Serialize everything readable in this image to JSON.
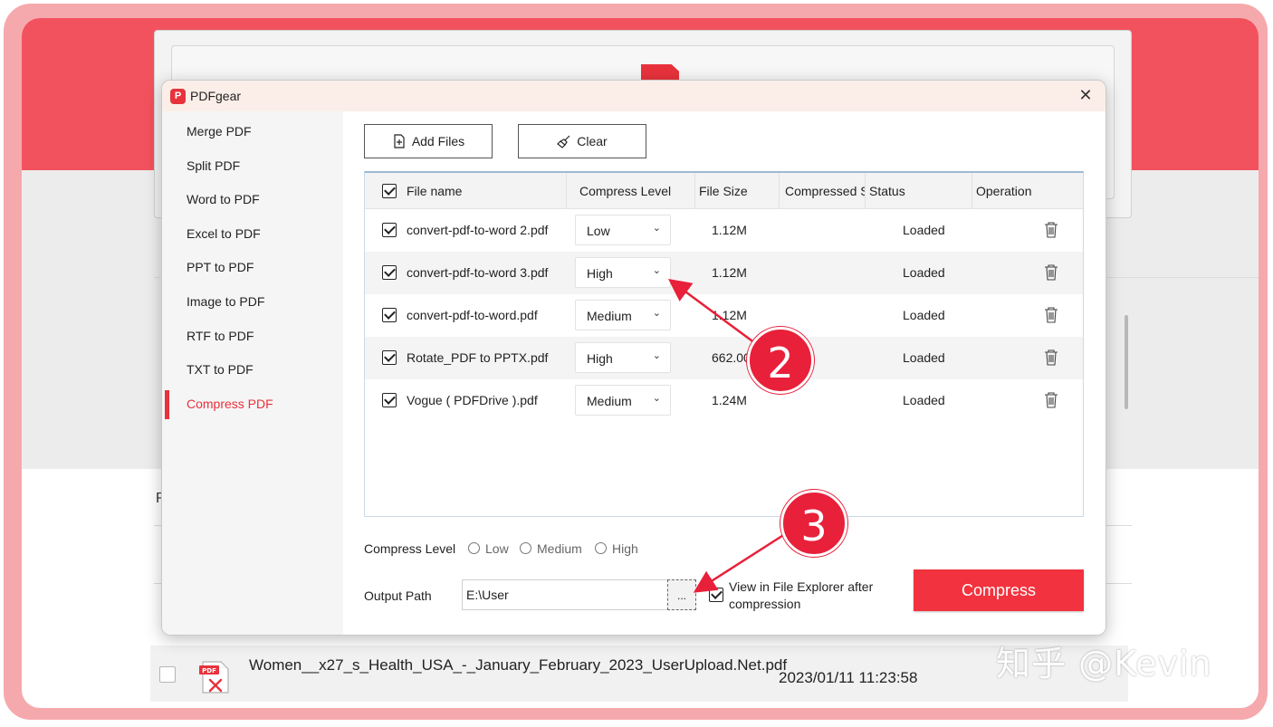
{
  "app": {
    "title": "PDFgear",
    "close_glyph": "✕",
    "icon": "pdfgear-logo-icon"
  },
  "sidebar": {
    "items": [
      {
        "label": "Merge PDF"
      },
      {
        "label": "Split PDF"
      },
      {
        "label": "Word to PDF"
      },
      {
        "label": "Excel to PDF"
      },
      {
        "label": "PPT to PDF"
      },
      {
        "label": "Image to PDF"
      },
      {
        "label": "RTF to PDF"
      },
      {
        "label": "TXT to PDF"
      },
      {
        "label": "Compress PDF",
        "active": true
      }
    ]
  },
  "toolbar": {
    "add_files_label": "Add Files",
    "clear_label": "Clear"
  },
  "table": {
    "columns": {
      "file_name": "File name",
      "compress_level": "Compress Level",
      "file_size": "File Size",
      "compressed_size": "Compressed Size",
      "status": "Status",
      "operation": "Operation"
    },
    "rows": [
      {
        "name": "convert-pdf-to-word 2.pdf",
        "level": "Low",
        "size": "1.12M",
        "status": "Loaded",
        "checked": true
      },
      {
        "name": "convert-pdf-to-word 3.pdf",
        "level": "High",
        "size": "1.12M",
        "status": "Loaded",
        "checked": true
      },
      {
        "name": "convert-pdf-to-word.pdf",
        "level": "Medium",
        "size": "1.12M",
        "status": "Loaded",
        "checked": true
      },
      {
        "name": "Rotate_PDF to PPTX.pdf",
        "level": "High",
        "size": "662.00",
        "status": "Loaded",
        "checked": true
      },
      {
        "name": "Vogue ( PDFDrive ).pdf",
        "level": "Medium",
        "size": "1.24M",
        "status": "Loaded",
        "checked": true
      }
    ]
  },
  "options": {
    "compress_level_label": "Compress Level",
    "levels": [
      "Low",
      "Medium",
      "High"
    ],
    "output_path_label": "Output Path",
    "output_path_value": "E:\\User",
    "browse_label": "...",
    "view_in_explorer_label": "View in File Explorer after compression",
    "view_in_explorer_checked": true,
    "compress_button_label": "Compress"
  },
  "annotations": {
    "step2": "2",
    "step3": "3",
    "color": "#e8203a"
  },
  "background": {
    "partial_letter": "R",
    "file_name": "Women__x27_s_Health_USA_-_January_February_2023_UserUpload.Net.pdf",
    "file_date": "2023/01/11 11:23:58",
    "pdf_icon_text": "PDF",
    "watermark": "知乎 @Kevin"
  },
  "colors": {
    "accent": "#e8323c",
    "header_band": "#f2525e",
    "frame": "#f6a9ad"
  }
}
